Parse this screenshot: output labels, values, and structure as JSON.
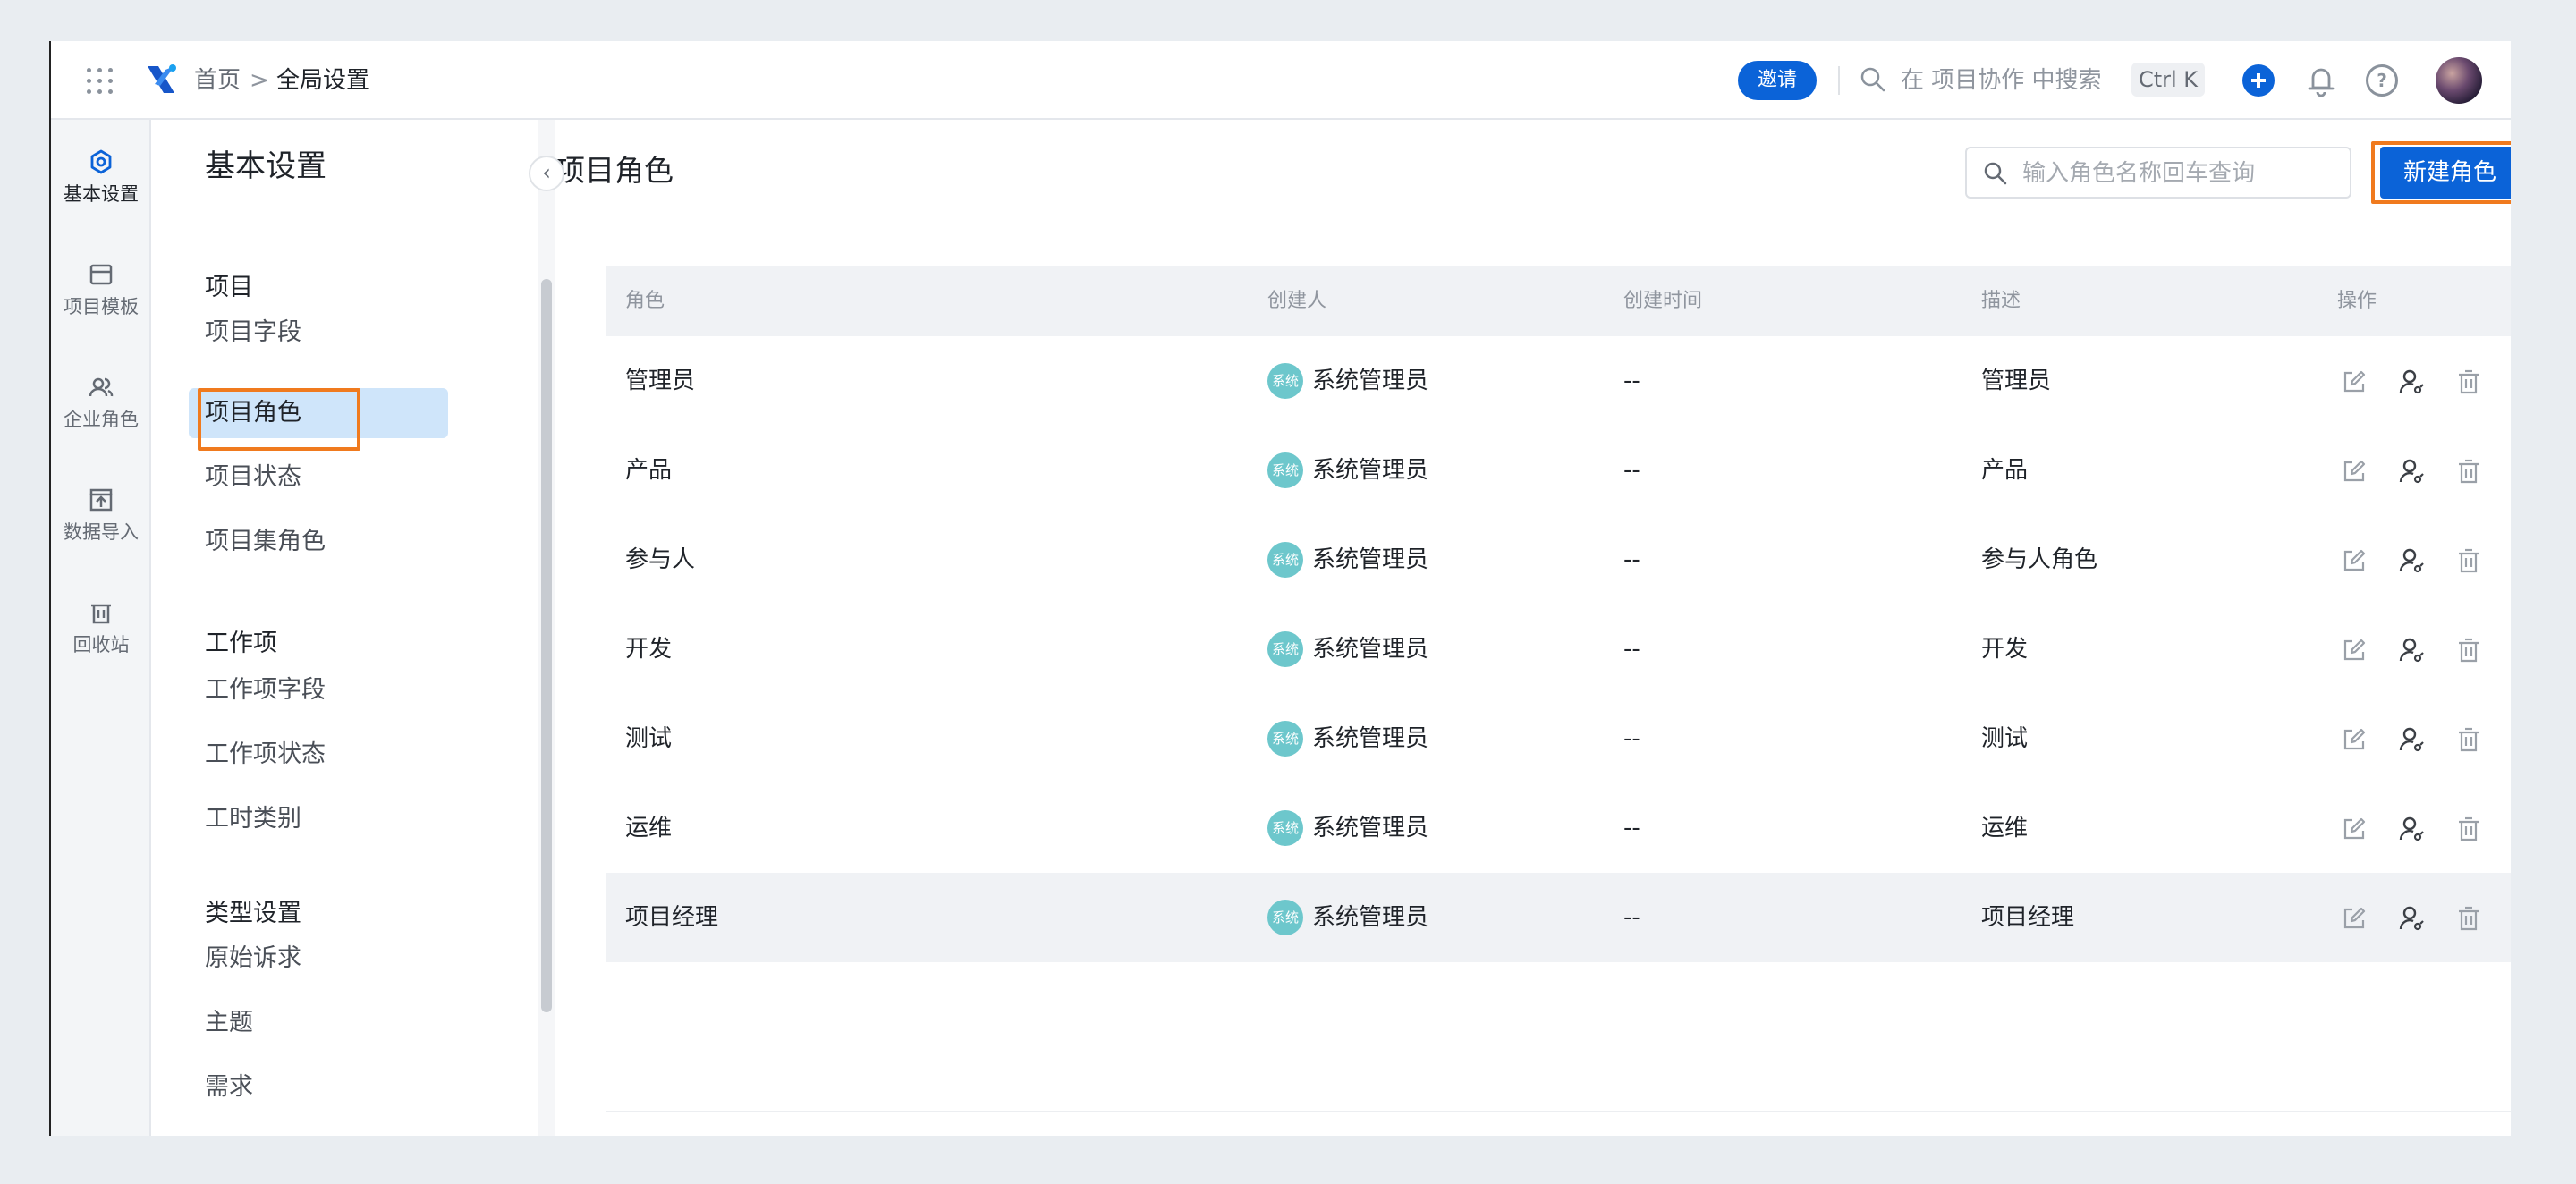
{
  "breadcrumb": {
    "home": "首页",
    "separator": ">",
    "current": "全局设置"
  },
  "topbar": {
    "invite_label": "邀请",
    "search_placeholder": "在 项目协作 中搜索",
    "shortcut": "Ctrl K"
  },
  "rail": {
    "items": [
      {
        "label": "基本设置",
        "icon": "settings-hex-icon",
        "active": true
      },
      {
        "label": "项目模板",
        "icon": "template-icon"
      },
      {
        "label": "企业角色",
        "icon": "users-icon"
      },
      {
        "label": "数据导入",
        "icon": "import-icon"
      },
      {
        "label": "回收站",
        "icon": "trash-icon"
      }
    ]
  },
  "nav": {
    "title": "基本设置",
    "collapse_glyph": "‹",
    "groups": [
      {
        "title": "项目",
        "items": [
          "项目字段",
          "项目角色",
          "项目状态",
          "项目集角色"
        ]
      },
      {
        "title": "工作项",
        "items": [
          "工作项字段",
          "工作项状态",
          "工时类别"
        ]
      },
      {
        "title": "类型设置",
        "items": [
          "原始诉求",
          "主题",
          "需求"
        ]
      }
    ],
    "active_item": "项目角色"
  },
  "main": {
    "title": "项目角色",
    "search_placeholder": "输入角色名称回车查询",
    "new_button": "新建角色",
    "columns": [
      "角色",
      "创建人",
      "创建时间",
      "描述",
      "操作"
    ],
    "rows": [
      {
        "role": "管理员",
        "creator_badge": "系统",
        "creator": "系统管理员",
        "created": "--",
        "desc": "管理员"
      },
      {
        "role": "产品",
        "creator_badge": "系统",
        "creator": "系统管理员",
        "created": "--",
        "desc": "产品"
      },
      {
        "role": "参与人",
        "creator_badge": "系统",
        "creator": "系统管理员",
        "created": "--",
        "desc": "参与人角色"
      },
      {
        "role": "开发",
        "creator_badge": "系统",
        "creator": "系统管理员",
        "created": "--",
        "desc": "开发"
      },
      {
        "role": "测试",
        "creator_badge": "系统",
        "creator": "系统管理员",
        "created": "--",
        "desc": "测试"
      },
      {
        "role": "运维",
        "creator_badge": "系统",
        "creator": "系统管理员",
        "created": "--",
        "desc": "运维"
      },
      {
        "role": "项目经理",
        "creator_badge": "系统",
        "creator": "系统管理员",
        "created": "--",
        "desc": "项目经理"
      }
    ]
  },
  "colors": {
    "primary": "#0b63d8",
    "highlight": "#f07a1e",
    "badge": "#6dc7cc",
    "active_nav": "#cfe5fa"
  }
}
